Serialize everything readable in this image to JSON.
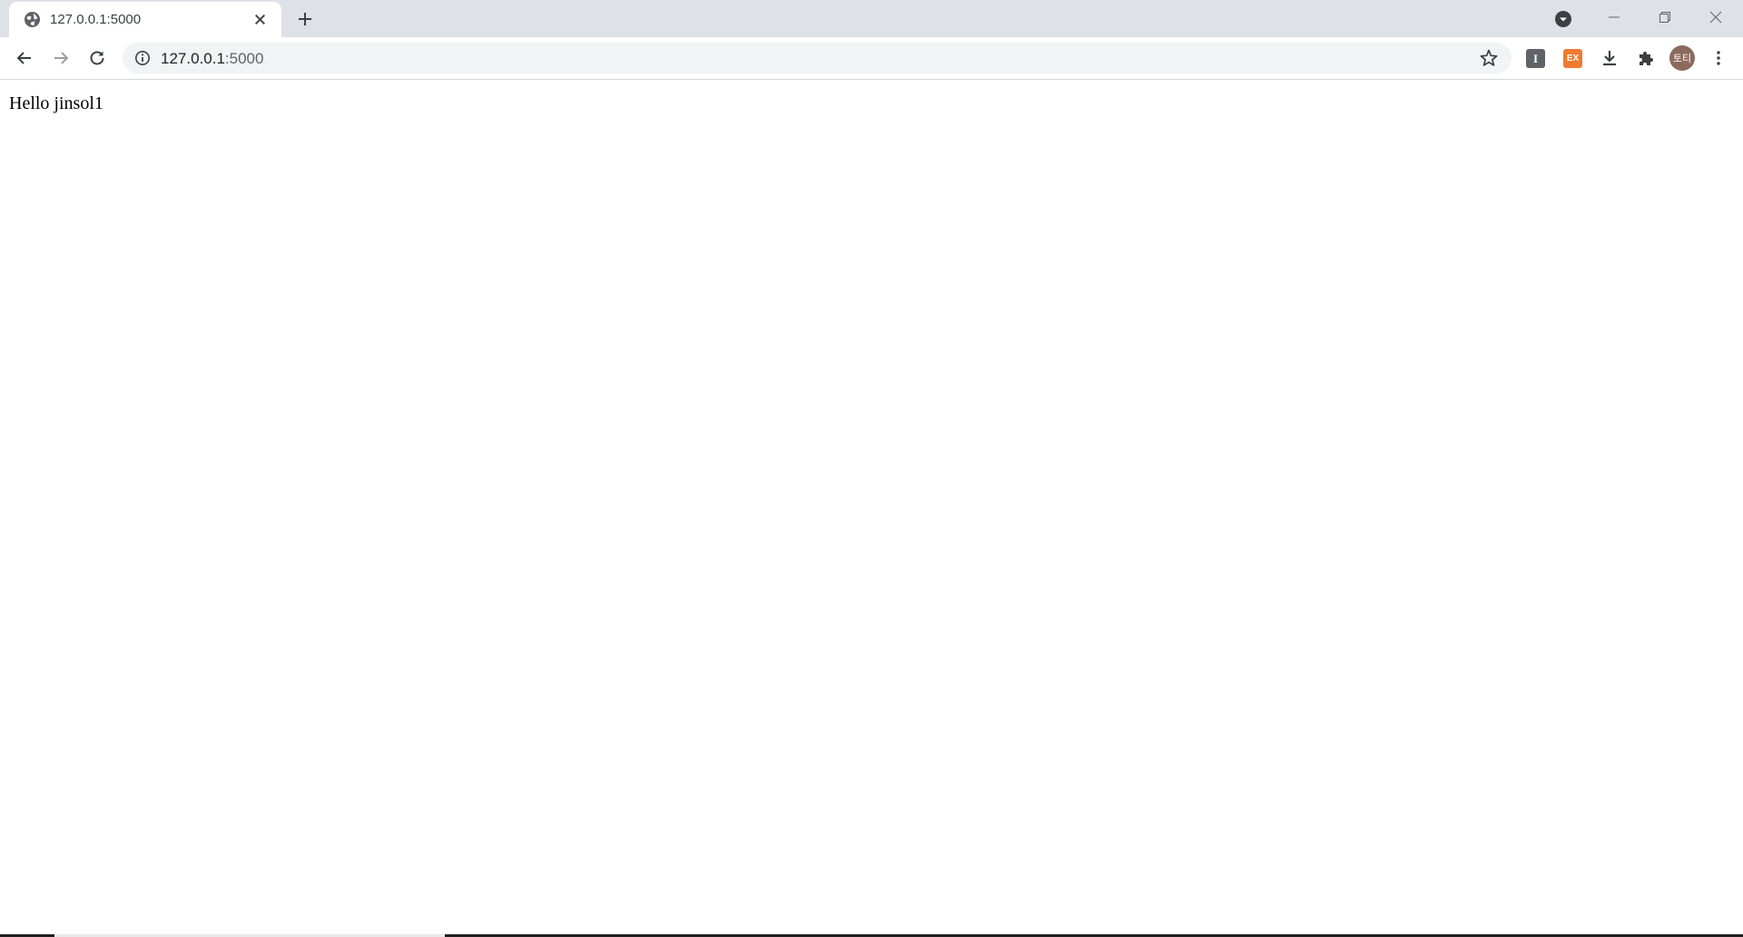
{
  "tab": {
    "title": "127.0.0.1:5000"
  },
  "omnibox": {
    "url_host": "127.0.0.1",
    "url_port": ":5000"
  },
  "extensions": {
    "ext1_label": "I",
    "ext2_label": "EX"
  },
  "profile": {
    "avatar_label": "토티"
  },
  "page": {
    "text": "Hello jinsol1"
  },
  "colors": {
    "tabstrip_bg": "#dee1e6",
    "omnibox_bg": "#f1f3f4",
    "ext_ex_bg": "#f07a30",
    "avatar_bg": "#8b6a5c"
  }
}
